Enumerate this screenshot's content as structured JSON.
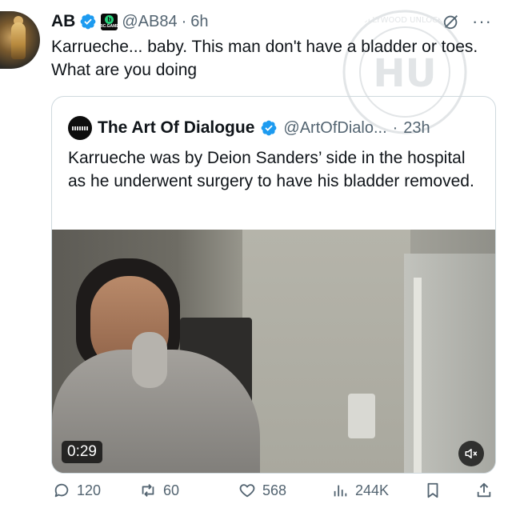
{
  "tweet": {
    "author": {
      "name": "AB",
      "handle": "@AB84",
      "affiliate_badge": "BC.GAME"
    },
    "separator": "·",
    "time": "6h",
    "text": "Karrueche... baby. This man don't have a bladder or toes. What are you doing",
    "more_label": "···"
  },
  "watermark": {
    "text": "HOLLYWOOD UNLOCKED",
    "monogram": "HU"
  },
  "quote": {
    "author": {
      "name": "The Art Of Dialogue",
      "handle": "@ArtOfDialo...",
      "avatar_text": "DIALOGUE"
    },
    "separator": "·",
    "time": "23h",
    "text": "Karrueche was by Deion Sanders’ side in the hospital as he underwent surgery to have his bladder removed.",
    "video": {
      "duration": "0:29"
    }
  },
  "actions": {
    "replies": "120",
    "reposts": "60",
    "likes": "568",
    "views": "244K"
  },
  "colors": {
    "verified": "#1d9bf0",
    "text_primary": "#0f1419",
    "text_secondary": "#536471",
    "border": "#cfd9de"
  },
  "icons": [
    "verified-icon",
    "bcgame-badge-icon",
    "grok-icon",
    "more-icon",
    "mute-icon",
    "reply-icon",
    "repost-icon",
    "like-icon",
    "views-icon",
    "bookmark-icon",
    "share-icon"
  ]
}
